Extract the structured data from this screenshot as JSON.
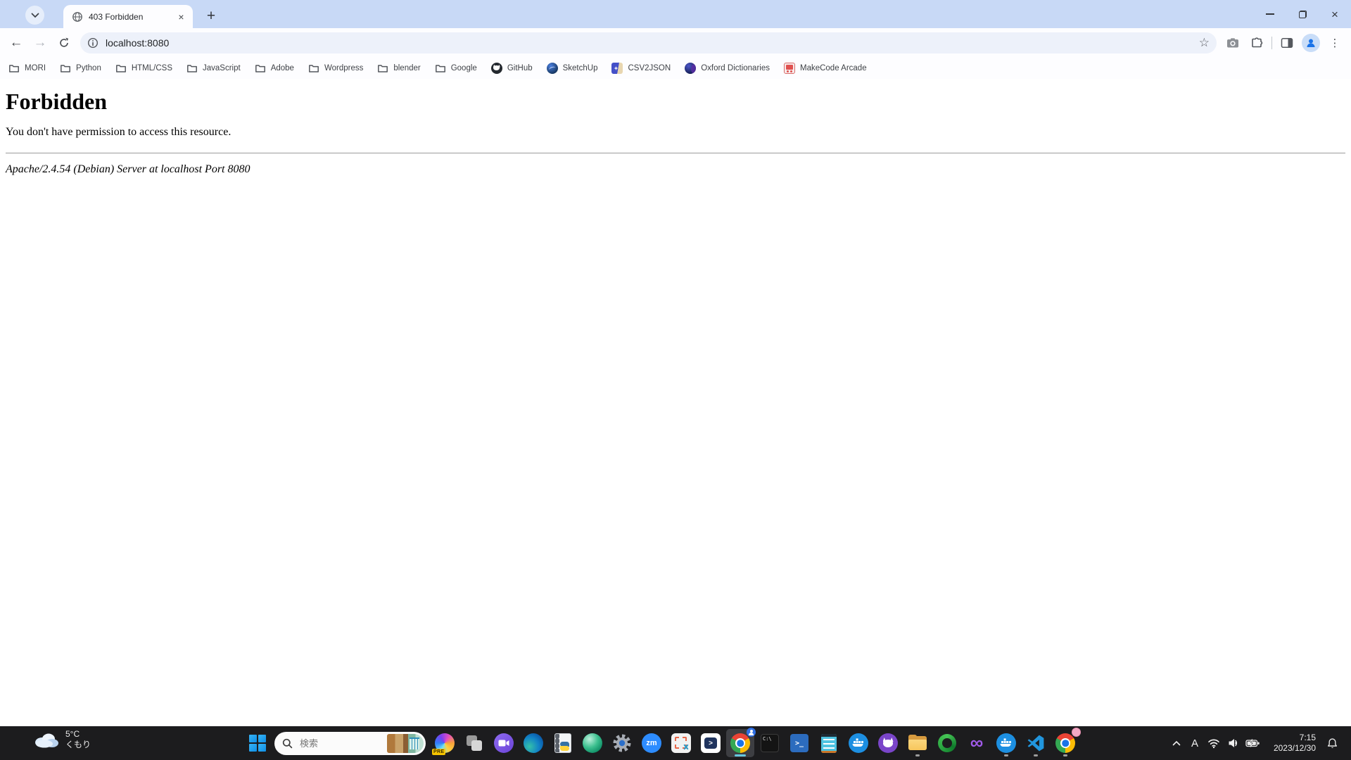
{
  "browser": {
    "tab_title": "403 Forbidden",
    "url": "localhost:8080",
    "bookmarks": [
      {
        "label": "MORI",
        "icon": "folder-icon"
      },
      {
        "label": "Python",
        "icon": "folder-icon"
      },
      {
        "label": "HTML/CSS",
        "icon": "folder-icon"
      },
      {
        "label": "JavaScript",
        "icon": "folder-icon"
      },
      {
        "label": "Adobe",
        "icon": "folder-icon"
      },
      {
        "label": "Wordpress",
        "icon": "folder-icon"
      },
      {
        "label": "blender",
        "icon": "folder-icon"
      },
      {
        "label": "Google",
        "icon": "folder-icon"
      },
      {
        "label": "GitHub",
        "icon": "github-icon"
      },
      {
        "label": "SketchUp",
        "icon": "sketchup-icon"
      },
      {
        "label": "CSV2JSON",
        "icon": "csv2json-icon"
      },
      {
        "label": "Oxford Dictionaries",
        "icon": "oxford-icon"
      },
      {
        "label": "MakeCode Arcade",
        "icon": "makecode-icon"
      }
    ],
    "glyphs": {
      "back": "←",
      "forward": "→",
      "menu": "⋮",
      "star": "☆",
      "tab_close": "×",
      "window_close": "×",
      "new_tab": "+"
    }
  },
  "page": {
    "heading": "Forbidden",
    "message": "You don't have permission to access this resource.",
    "server_signature": "Apache/2.4.54 (Debian) Server at localhost Port 8080"
  },
  "taskbar": {
    "weather": {
      "temperature": "5°C",
      "condition": "くもり"
    },
    "search": {
      "placeholder": "検索"
    },
    "app_labels": {
      "copilot_badge": "PRE",
      "zoom": "zm",
      "cmd": "C:\\",
      "powershell": ">_",
      "visual_studio": "∞"
    },
    "apps": [
      "copilot",
      "widgets-squares",
      "video-chat",
      "microsoft-edge",
      "python-file",
      "green-globe",
      "settings",
      "zoom",
      "snipping-tool",
      "dev-chat",
      "chrome-profile-active",
      "command-prompt",
      "powershell",
      "notepad",
      "docker",
      "github-desktop",
      "file-explorer",
      "green-ring",
      "visual-studio",
      "docker-2",
      "vscode",
      "chrome-profile-pink"
    ],
    "tray": {
      "ime": "A",
      "time": "7:15",
      "date": "2023/12/30"
    }
  },
  "colors": {
    "titlebar": "#c8d9f6",
    "toolbar": "#fdfdff",
    "omnibox": "#edf1fa",
    "taskbar": "#1c1c1e",
    "active_underline": "#66c8e0",
    "chrome_red": "#ea4335",
    "chrome_yellow": "#fbbc05",
    "chrome_green": "#34a853",
    "chrome_blue": "#1a73e8"
  }
}
